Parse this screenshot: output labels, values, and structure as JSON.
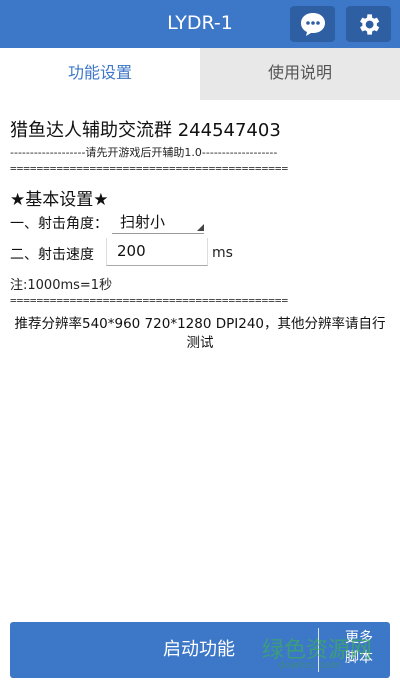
{
  "app": {
    "title": "LYDR-1"
  },
  "header": {
    "chat_icon": "chat-bubble-icon",
    "settings_icon": "gear-icon"
  },
  "tabs": [
    {
      "label": "功能设置",
      "active": true
    },
    {
      "label": "使用说明",
      "active": false
    }
  ],
  "main": {
    "group_line": "猎鱼达人辅助交流群 244547403",
    "notice_line": "-------------------请先开游戏后开辅助1.0-------------------",
    "separator": "==========================================",
    "section_title": "★基本设置★",
    "angle": {
      "label": "一、射击角度：",
      "value": "扫射小"
    },
    "speed": {
      "label": "二、射击速度",
      "value": "200",
      "unit": "ms"
    },
    "note": "注:1000ms=1秒",
    "recommend": "推荐分辨率540*960 720*1280 DPI240，其他分辨率请自行测试"
  },
  "footer": {
    "start_label": "启动功能",
    "more_label_1": "更多",
    "more_label_2": "脚本"
  },
  "watermark": {
    "text": "绿色资源网",
    "sub": "downcc.com"
  },
  "colors": {
    "primary": "#3d77c8",
    "primary_dark": "#2f5fa3",
    "tab_inactive_bg": "#e8e8e8"
  }
}
